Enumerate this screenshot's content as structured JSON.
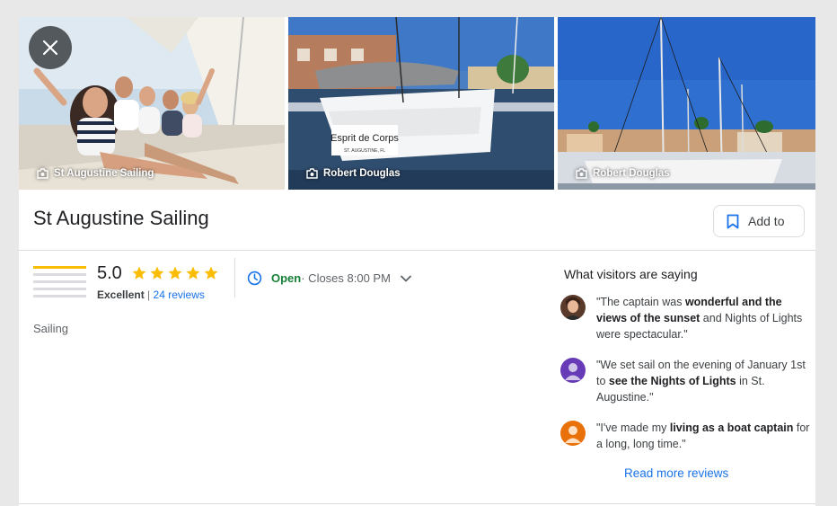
{
  "photos": [
    {
      "credit": "St Augustine Sailing"
    },
    {
      "credit": "Robert Douglas",
      "boat_name": "Esprit de Corps",
      "boat_home": "ST. AUGUSTINE, FL"
    },
    {
      "credit": "Robert Douglas"
    }
  ],
  "place": {
    "title": "St Augustine Sailing",
    "save_label": "Add to",
    "category": "Sailing"
  },
  "rating": {
    "score": "5.0",
    "stars": 5,
    "label": "Excellent",
    "separator": "|",
    "reviews_link": "24 reviews"
  },
  "hours": {
    "status": "Open",
    "detail": " · Closes 8:00 PM"
  },
  "visitors": {
    "title": "What visitors are saying",
    "reviews": [
      {
        "pre": "\"The captain was ",
        "bold": "wonderful and the views of the sunset",
        "post": " and Nights of Lights were spectacular.\""
      },
      {
        "pre": "\"We set sail on the evening of January 1st to ",
        "bold": "see the Nights of Lights",
        "post": " in St. Augustine.\""
      },
      {
        "pre": "\"I've made my ",
        "bold": "living as a boat captain",
        "post": " for a long, long time.\""
      }
    ],
    "read_more": "Read more reviews"
  },
  "colors": {
    "accent_blue": "#1a73e8",
    "open_green": "#188038",
    "star_yellow": "#fbbc04",
    "avatar_purple": "#673ab7",
    "avatar_orange": "#e8710a"
  },
  "icons": {
    "close": "close-icon",
    "camera": "camera-icon",
    "bookmark": "bookmark-icon",
    "star": "star-icon",
    "clock": "clock-icon",
    "expand": "chevron-down-icon",
    "person": "person-icon"
  }
}
